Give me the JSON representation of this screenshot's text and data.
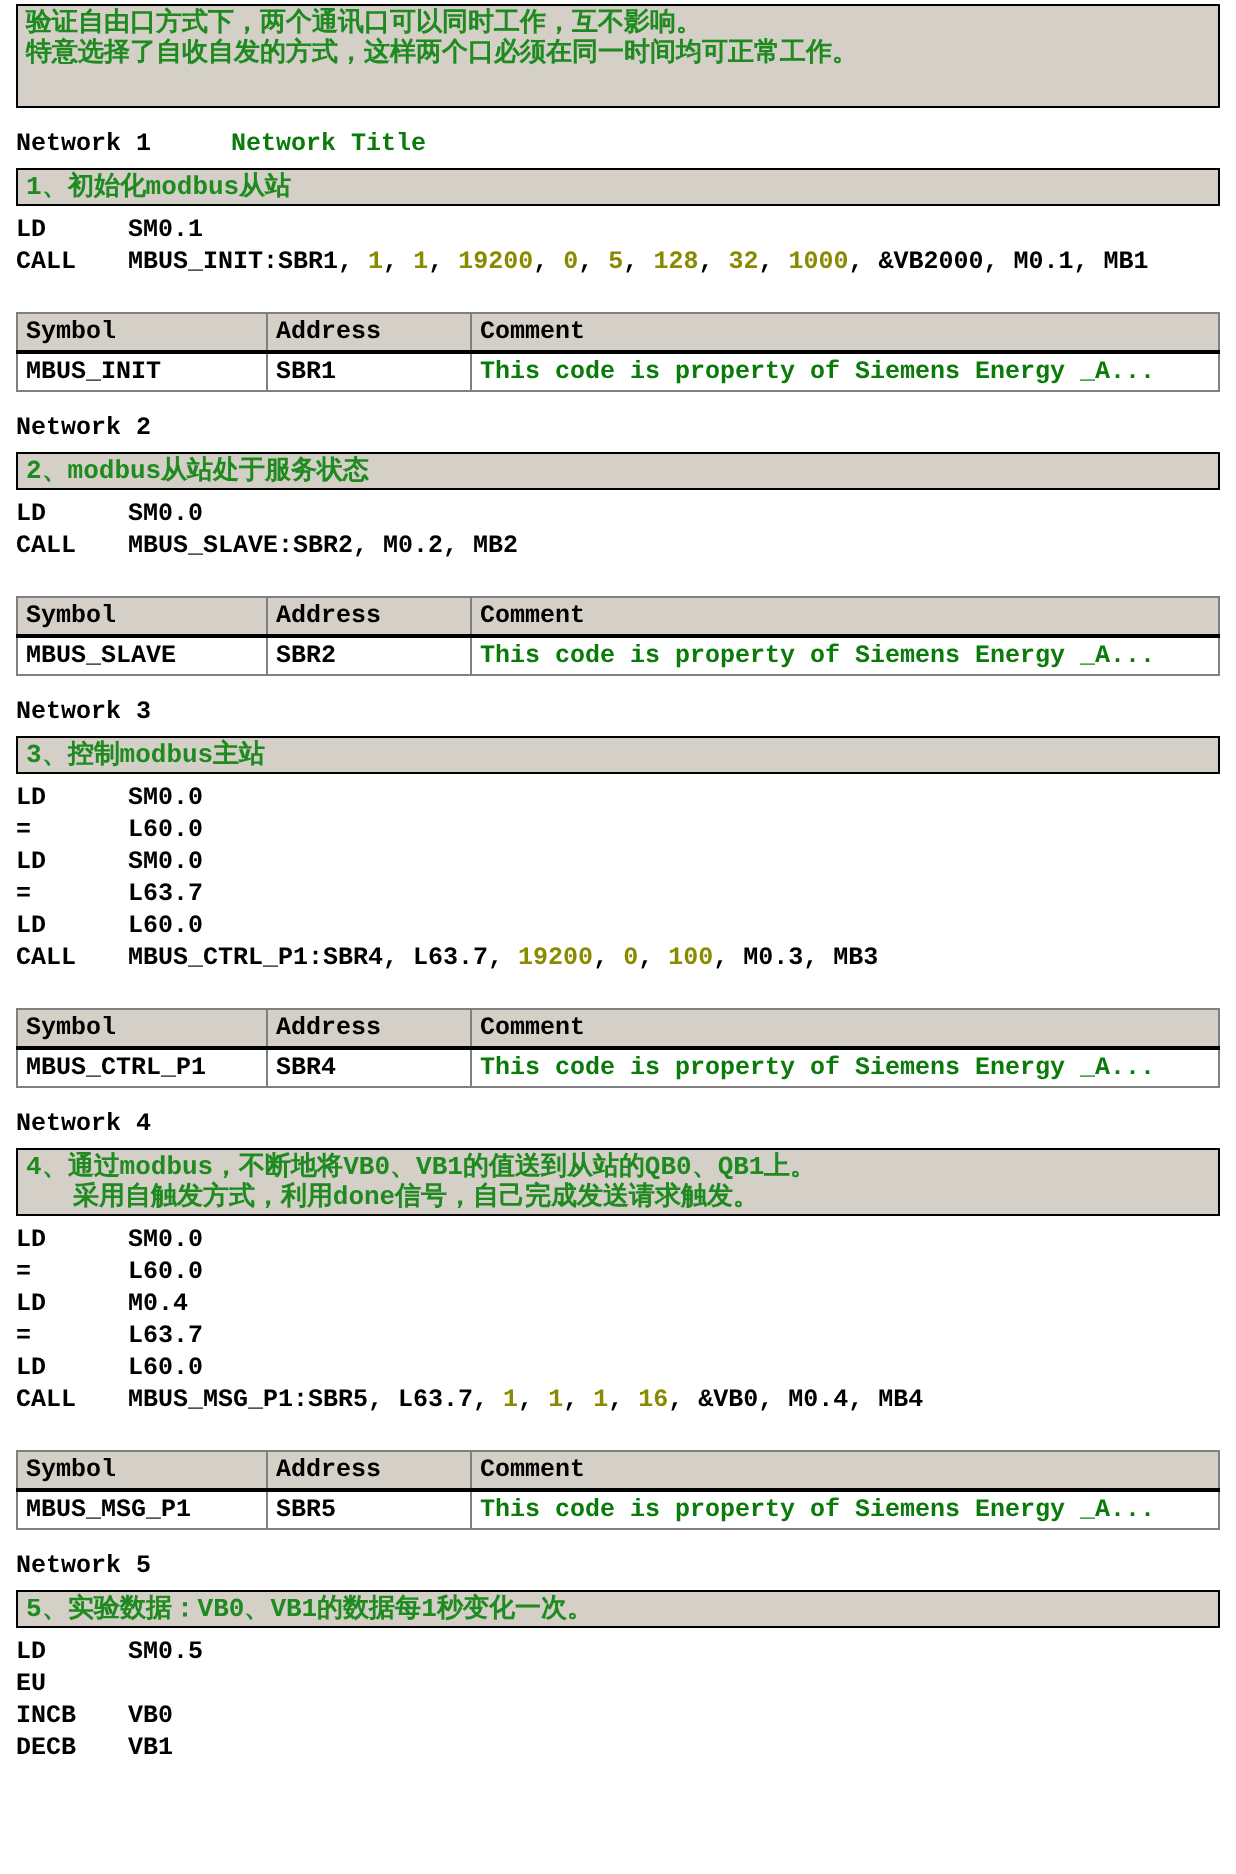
{
  "header_comment": [
    "验证自由口方式下，两个通讯口可以同时工作，互不影响。",
    "特意选择了自收自发的方式，这样两个口必须在同一时间均可正常工作。"
  ],
  "networks": [
    {
      "label": "Network 1",
      "title": "Network Title",
      "comment": [
        "1、初始化modbus从站"
      ],
      "code": [
        {
          "op": "LD",
          "operand": [
            {
              "text": "SM0.1",
              "kind": "plain"
            }
          ]
        },
        {
          "op": "CALL",
          "operand": [
            {
              "text": "MBUS_INIT:SBR1, ",
              "kind": "plain"
            },
            {
              "text": "1",
              "kind": "const"
            },
            {
              "text": ", ",
              "kind": "plain"
            },
            {
              "text": "1",
              "kind": "const"
            },
            {
              "text": ", ",
              "kind": "plain"
            },
            {
              "text": "19200",
              "kind": "const"
            },
            {
              "text": ", ",
              "kind": "plain"
            },
            {
              "text": "0",
              "kind": "const"
            },
            {
              "text": ", ",
              "kind": "plain"
            },
            {
              "text": "5",
              "kind": "const"
            },
            {
              "text": ", ",
              "kind": "plain"
            },
            {
              "text": "128",
              "kind": "const"
            },
            {
              "text": ", ",
              "kind": "plain"
            },
            {
              "text": "32",
              "kind": "const"
            },
            {
              "text": ", ",
              "kind": "plain"
            },
            {
              "text": "1000",
              "kind": "const"
            },
            {
              "text": ", &VB2000, M0.1, MB1",
              "kind": "plain"
            }
          ]
        }
      ],
      "symbols": {
        "columns": [
          "Symbol",
          "Address",
          "Comment"
        ],
        "rows": [
          {
            "symbol": "MBUS_INIT",
            "address": "SBR1",
            "comment": "This code is property of Siemens Energy _A..."
          }
        ]
      }
    },
    {
      "label": "Network 2",
      "comment": [
        "2、modbus从站处于服务状态"
      ],
      "code": [
        {
          "op": "LD",
          "operand": [
            {
              "text": "SM0.0",
              "kind": "plain"
            }
          ]
        },
        {
          "op": "CALL",
          "operand": [
            {
              "text": "MBUS_SLAVE:SBR2, M0.2, MB2",
              "kind": "plain"
            }
          ]
        }
      ],
      "symbols": {
        "columns": [
          "Symbol",
          "Address",
          "Comment"
        ],
        "rows": [
          {
            "symbol": "MBUS_SLAVE",
            "address": "SBR2",
            "comment": "This code is property of Siemens Energy _A..."
          }
        ]
      }
    },
    {
      "label": "Network 3",
      "comment": [
        "3、控制modbus主站"
      ],
      "code": [
        {
          "op": "LD",
          "operand": [
            {
              "text": "SM0.0",
              "kind": "plain"
            }
          ]
        },
        {
          "op": "=",
          "operand": [
            {
              "text": "L60.0",
              "kind": "plain"
            }
          ]
        },
        {
          "op": "LD",
          "operand": [
            {
              "text": "SM0.0",
              "kind": "plain"
            }
          ]
        },
        {
          "op": "=",
          "operand": [
            {
              "text": "L63.7",
              "kind": "plain"
            }
          ]
        },
        {
          "op": "LD",
          "operand": [
            {
              "text": "L60.0",
              "kind": "plain"
            }
          ]
        },
        {
          "op": "CALL",
          "operand": [
            {
              "text": "MBUS_CTRL_P1:SBR4, L63.7, ",
              "kind": "plain"
            },
            {
              "text": "19200",
              "kind": "const"
            },
            {
              "text": ", ",
              "kind": "plain"
            },
            {
              "text": "0",
              "kind": "const"
            },
            {
              "text": ", ",
              "kind": "plain"
            },
            {
              "text": "100",
              "kind": "const"
            },
            {
              "text": ", M0.3, MB3",
              "kind": "plain"
            }
          ]
        }
      ],
      "symbols": {
        "columns": [
          "Symbol",
          "Address",
          "Comment"
        ],
        "rows": [
          {
            "symbol": "MBUS_CTRL_P1",
            "address": "SBR4",
            "comment": "This code is property of Siemens Energy _A..."
          }
        ]
      }
    },
    {
      "label": "Network 4",
      "comment": [
        "4、通过modbus，不断地将VB0、VB1的值送到从站的QB0、QB1上。",
        "   采用自触发方式，利用done信号，自己完成发送请求触发。"
      ],
      "code": [
        {
          "op": "LD",
          "operand": [
            {
              "text": "SM0.0",
              "kind": "plain"
            }
          ]
        },
        {
          "op": "=",
          "operand": [
            {
              "text": "L60.0",
              "kind": "plain"
            }
          ]
        },
        {
          "op": "LD",
          "operand": [
            {
              "text": "M0.4",
              "kind": "plain"
            }
          ]
        },
        {
          "op": "=",
          "operand": [
            {
              "text": "L63.7",
              "kind": "plain"
            }
          ]
        },
        {
          "op": "LD",
          "operand": [
            {
              "text": "L60.0",
              "kind": "plain"
            }
          ]
        },
        {
          "op": "CALL",
          "operand": [
            {
              "text": "MBUS_MSG_P1:SBR5, L63.7, ",
              "kind": "plain"
            },
            {
              "text": "1",
              "kind": "const"
            },
            {
              "text": ", ",
              "kind": "plain"
            },
            {
              "text": "1",
              "kind": "const"
            },
            {
              "text": ", ",
              "kind": "plain"
            },
            {
              "text": "1",
              "kind": "const"
            },
            {
              "text": ", ",
              "kind": "plain"
            },
            {
              "text": "16",
              "kind": "const"
            },
            {
              "text": ", &VB0, M0.4, MB4",
              "kind": "plain"
            }
          ]
        }
      ],
      "symbols": {
        "columns": [
          "Symbol",
          "Address",
          "Comment"
        ],
        "rows": [
          {
            "symbol": "MBUS_MSG_P1",
            "address": "SBR5",
            "comment": "This code is property of Siemens Energy _A..."
          }
        ]
      }
    },
    {
      "label": "Network 5",
      "comment": [
        "5、实验数据：VB0、VB1的数据每1秒变化一次。"
      ],
      "code": [
        {
          "op": "LD",
          "operand": [
            {
              "text": "SM0.5",
              "kind": "plain"
            }
          ]
        },
        {
          "op": "EU"
        },
        {
          "op": "INCB",
          "operand": [
            {
              "text": "VB0",
              "kind": "plain"
            }
          ]
        },
        {
          "op": "DECB",
          "operand": [
            {
              "text": "VB1",
              "kind": "plain"
            }
          ]
        }
      ]
    }
  ]
}
